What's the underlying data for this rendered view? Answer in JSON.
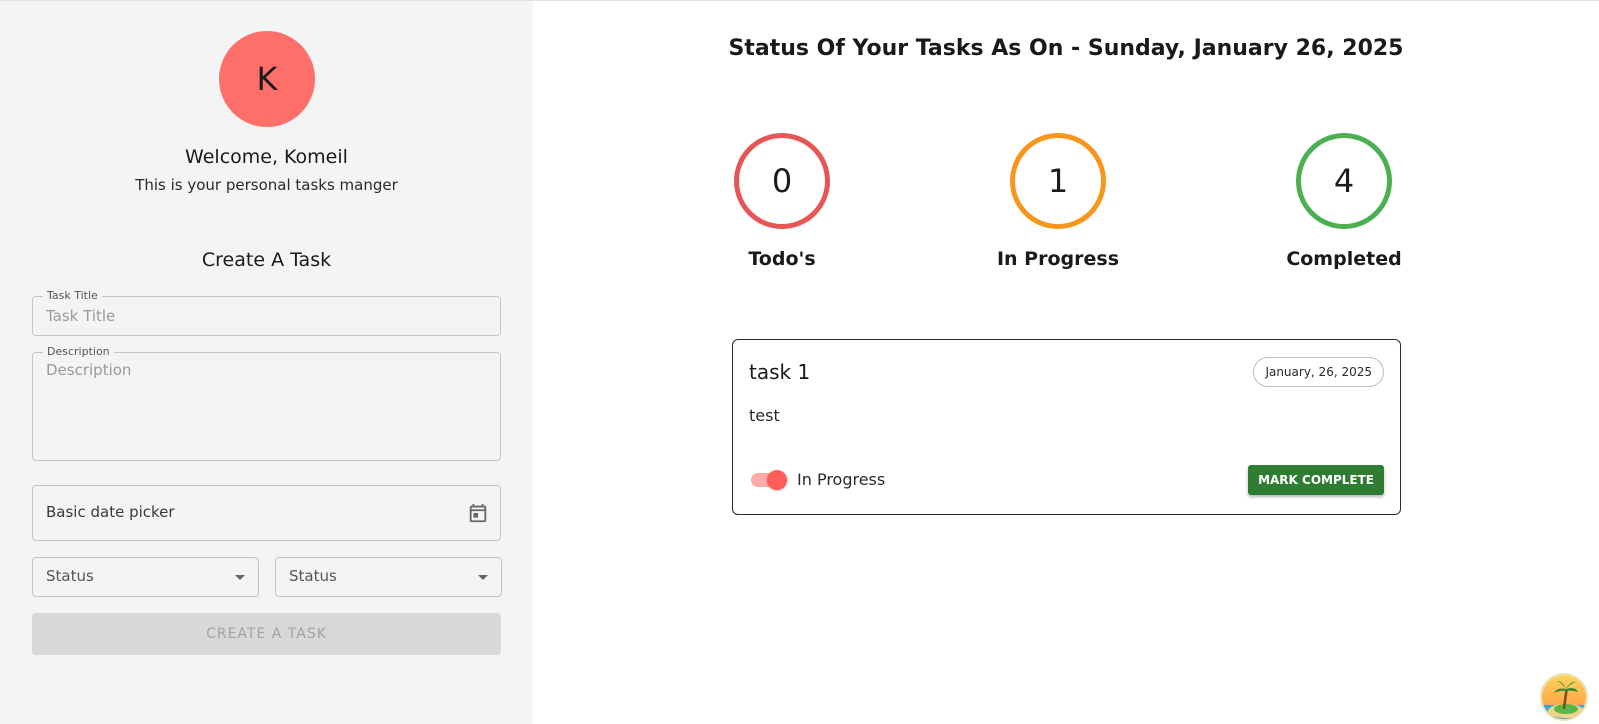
{
  "colors": {
    "sidebar_bg": "#f4f4f4",
    "avatar_bg": "#ff6f6a",
    "todo_ring": "#e85555",
    "in_progress_ring": "#f7961b",
    "completed_ring": "#4caf50",
    "mark_complete_bg": "#2e7d32",
    "toggle_on": "#ff5c5a"
  },
  "sidebar": {
    "avatar_initial": "K",
    "welcome": "Welcome, Komeil",
    "subtitle": "This is your personal tasks manger",
    "create_heading": "Create A Task",
    "task_title": {
      "label": "Task Title",
      "placeholder": "Task Title",
      "value": ""
    },
    "description": {
      "label": "Description",
      "placeholder": "Description",
      "value": ""
    },
    "date_picker": {
      "label": "Basic date picker",
      "icon": "calendar-icon"
    },
    "status_select_1": {
      "label": "Status",
      "icon": "chevron-down-icon"
    },
    "status_select_2": {
      "label": "Status",
      "icon": "chevron-down-icon"
    },
    "create_button": "CREATE A TASK"
  },
  "main": {
    "title": "Status Of Your Tasks As On - Sunday, January 26, 2025",
    "stats": [
      {
        "count": "0",
        "label": "Todo's"
      },
      {
        "count": "1",
        "label": "In Progress"
      },
      {
        "count": "4",
        "label": "Completed"
      }
    ],
    "tasks": [
      {
        "title": "task 1",
        "date": "January, 26, 2025",
        "description": "test",
        "status_label": "In Progress",
        "toggle_on": true,
        "action": "MARK COMPLETE"
      }
    ]
  },
  "corner_badge": {
    "icon": "island-icon"
  }
}
